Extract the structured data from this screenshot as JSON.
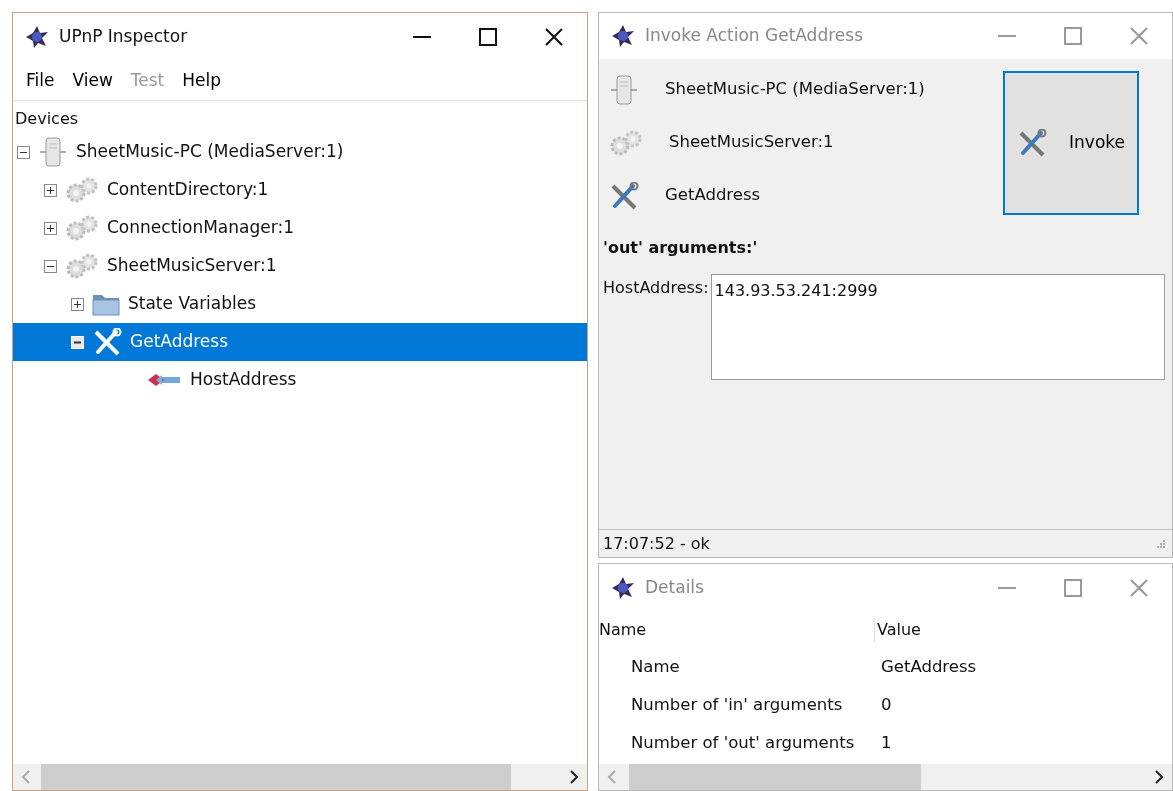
{
  "main_window": {
    "title": "UPnP Inspector",
    "active": true,
    "menu": [
      {
        "label": "File",
        "disabled": false
      },
      {
        "label": "View",
        "disabled": false
      },
      {
        "label": "Test",
        "disabled": true
      },
      {
        "label": "Help",
        "disabled": false
      }
    ],
    "tree": {
      "header": "Devices",
      "nodes": [
        {
          "kind": "device",
          "label": "SheetMusic-PC (MediaServer:1)",
          "expanded": true,
          "selected": false,
          "children": [
            {
              "kind": "service",
              "label": "ContentDirectory:1",
              "expanded": false,
              "selected": false
            },
            {
              "kind": "service",
              "label": "ConnectionManager:1",
              "expanded": false,
              "selected": false
            },
            {
              "kind": "service",
              "label": "SheetMusicServer:1",
              "expanded": true,
              "selected": false,
              "children": [
                {
                  "kind": "folder",
                  "label": "State Variables",
                  "expanded": false,
                  "selected": false
                },
                {
                  "kind": "action",
                  "label": "GetAddress",
                  "expanded": true,
                  "selected": true,
                  "children": [
                    {
                      "kind": "argument",
                      "label": "HostAddress",
                      "selected": false
                    }
                  ]
                }
              ]
            }
          ]
        }
      ]
    }
  },
  "invoke_window": {
    "title": "Invoke Action GetAddress",
    "active": false,
    "items": [
      {
        "kind": "device",
        "label": "SheetMusic-PC (MediaServer:1)"
      },
      {
        "kind": "service",
        "label": "SheetMusicServer:1"
      },
      {
        "kind": "action",
        "label": "GetAddress"
      }
    ],
    "button": "Invoke",
    "section": "'out' arguments:'",
    "arguments": [
      {
        "label": "HostAddress:",
        "value": "143.93.53.241:2999"
      }
    ],
    "status": "17:07:52 - ok"
  },
  "details_window": {
    "title": "Details",
    "active": false,
    "columns": [
      "Name",
      "Value"
    ],
    "rows": [
      {
        "name": "Name",
        "value": "GetAddress"
      },
      {
        "name": "Number of 'in' arguments",
        "value": "0"
      },
      {
        "name": "Number of 'out' arguments",
        "value": "1"
      }
    ]
  }
}
